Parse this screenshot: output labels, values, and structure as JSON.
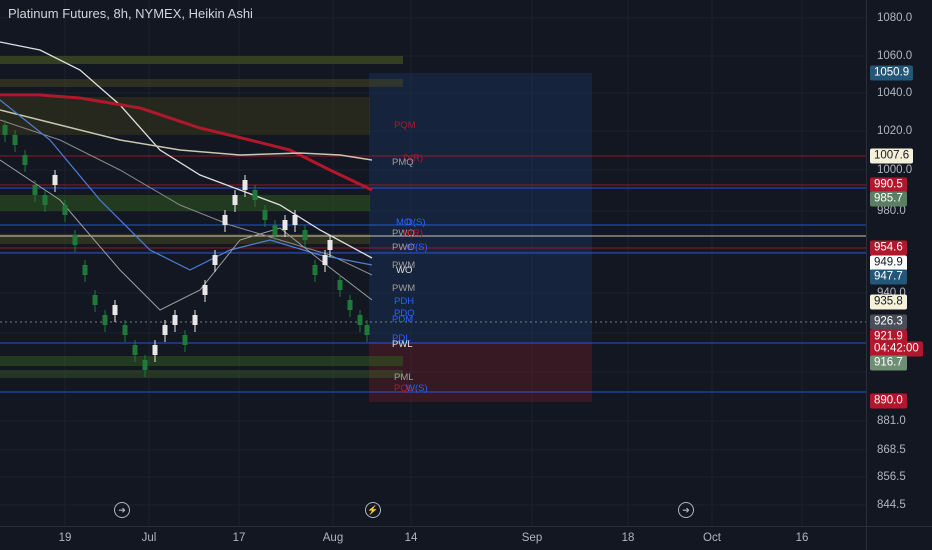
{
  "header": {
    "title": "Platinum Futures, 8h, NYMEX, Heikin Ashi"
  },
  "price_axis": {
    "ticks": [
      "1080.0",
      "1060.0",
      "1040.0",
      "1020.0",
      "1000.0",
      "980.0",
      "940.0",
      "881.0",
      "868.5",
      "856.5",
      "844.5"
    ],
    "badges": [
      {
        "text": "1050.9",
        "bg": "#22577a",
        "fg": "#ffffff"
      },
      {
        "text": "1007.6",
        "bg": "#f5f1d8",
        "fg": "#131722"
      },
      {
        "text": "990.5",
        "bg": "#b2182b",
        "fg": "#ffffff"
      },
      {
        "text": "985.7",
        "bg": "#5a7f63",
        "fg": "#ffffff"
      },
      {
        "text": "954.6",
        "bg": "#b2182b",
        "fg": "#ffffff"
      },
      {
        "text": "949.9",
        "bg": "#ffffff",
        "fg": "#131722"
      },
      {
        "text": "947.7",
        "bg": "#22577a",
        "fg": "#ffffff"
      },
      {
        "text": "935.8",
        "bg": "#f5f1d8",
        "fg": "#131722"
      },
      {
        "text": "926.3",
        "bg": "#4a4e59",
        "fg": "#ffffff"
      },
      {
        "text": "921.9",
        "bg": "#b2182b",
        "fg": "#ffffff"
      },
      {
        "text": "04:42:00",
        "bg": "#b2182b",
        "fg": "#ffffff"
      },
      {
        "text": "916.7",
        "bg": "#6f8f75",
        "fg": "#ffffff"
      },
      {
        "text": "890.0",
        "bg": "#b2182b",
        "fg": "#ffffff"
      }
    ]
  },
  "time_axis": {
    "ticks": [
      "19",
      "Jul",
      "17",
      "Aug",
      "14",
      "Sep",
      "18",
      "Oct",
      "16"
    ]
  },
  "chart_labels": [
    "PQM",
    "D(R)",
    "PMQ",
    "MO",
    "D(S)",
    "PWO",
    "H(R)",
    "PWO",
    "W(S)",
    "PWM",
    "WO",
    "PWM",
    "PDH",
    "PDO",
    "PDM",
    "PDL",
    "PWL",
    "PML",
    "PQL",
    "W(S)"
  ],
  "colors": {
    "background": "#131722",
    "up": "#e8e8e8",
    "down": "#1f7a3a",
    "accent": "#2962ff"
  },
  "event_icons": [
    "forward-icon",
    "lightning-icon",
    "forward-icon"
  ]
}
